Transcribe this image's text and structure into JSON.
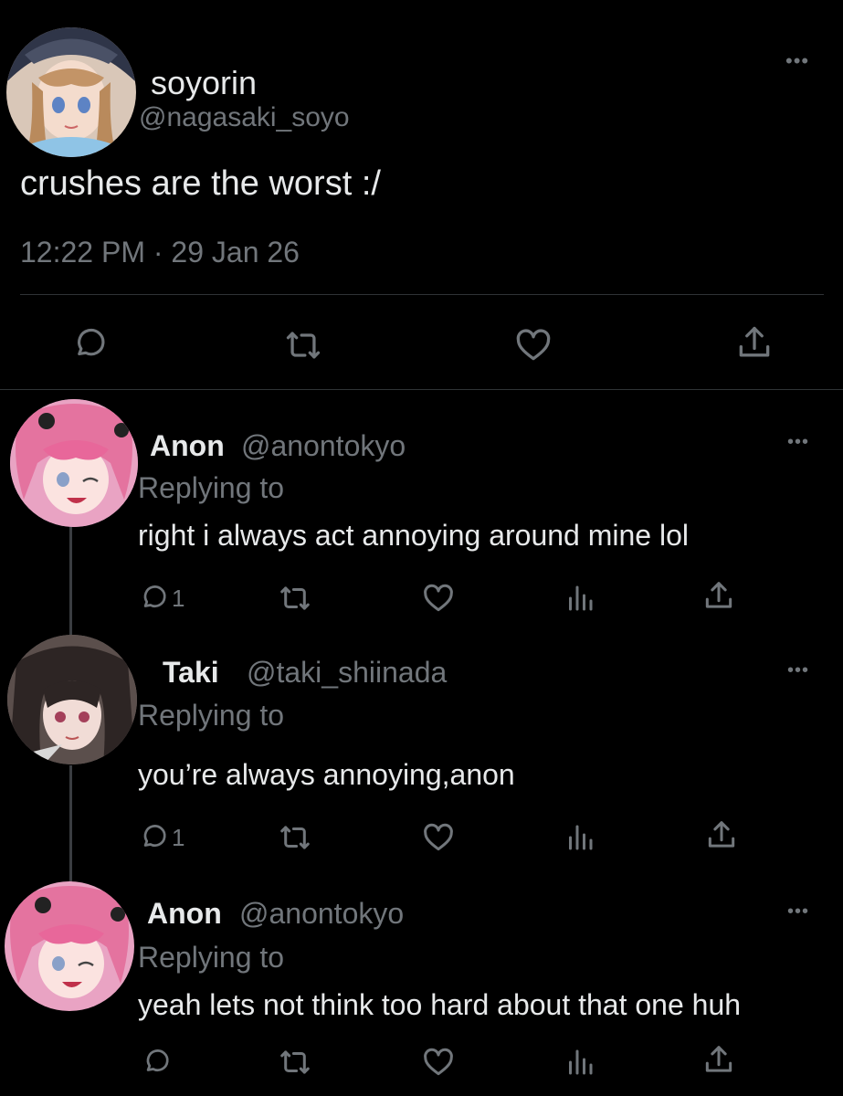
{
  "main_tweet": {
    "display_name": "soyorin",
    "handle": "@nagasaki_soyo",
    "text": "crushes are the worst :/",
    "timestamp": "12:22 PM · 29 Jan 26",
    "more_label": "•••"
  },
  "replies": [
    {
      "display_name": "Anon",
      "handle": "@anontokyo",
      "replying_to": "Replying to",
      "text": "right i always act annoying around mine lol",
      "reply_count": "1",
      "more_label": "•••"
    },
    {
      "display_name": "Taki",
      "handle": "@taki_shiinada",
      "replying_to": "Replying to",
      "text": "you’re always annoying,anon",
      "reply_count": "1",
      "more_label": "•••"
    },
    {
      "display_name": "Anon",
      "handle": "@anontokyo",
      "replying_to": "Replying to",
      "text": "yeah lets not think too hard about that one huh",
      "reply_count": "",
      "more_label": "•••"
    }
  ],
  "icons": [
    "reply-icon",
    "retweet-icon",
    "like-icon",
    "views-icon",
    "share-icon",
    "more-icon"
  ],
  "colors": {
    "background": "#000000",
    "text": "#e7e9ea",
    "secondary": "#71767b",
    "divider": "#2f3336"
  }
}
